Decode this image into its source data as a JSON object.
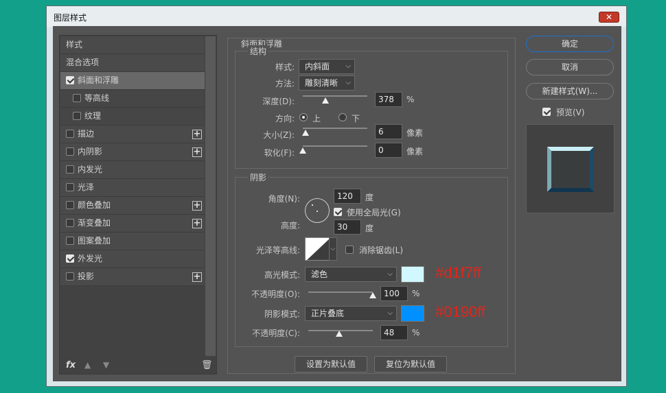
{
  "window": {
    "title": "图层样式",
    "close_label": "✕"
  },
  "sidebar": {
    "items": [
      {
        "label": "样式"
      },
      {
        "label": "混合选项"
      },
      {
        "label": "斜面和浮雕",
        "checked": true
      },
      {
        "label": "等高线",
        "checked": false
      },
      {
        "label": "纹理",
        "checked": false
      },
      {
        "label": "描边",
        "checked": false,
        "plus": "+"
      },
      {
        "label": "内阴影",
        "checked": false,
        "plus": "+"
      },
      {
        "label": "内发光",
        "checked": false
      },
      {
        "label": "光泽",
        "checked": false
      },
      {
        "label": "颜色叠加",
        "checked": false,
        "plus": "+"
      },
      {
        "label": "渐变叠加",
        "checked": false,
        "plus": "+"
      },
      {
        "label": "图案叠加",
        "checked": false
      },
      {
        "label": "外发光",
        "checked": true
      },
      {
        "label": "投影",
        "checked": false,
        "plus": "+"
      }
    ],
    "fx_label": "fx",
    "up_icon": "▲",
    "down_icon": "▼",
    "trash_icon": "🗑"
  },
  "main": {
    "title": "斜面和浮雕",
    "structure": {
      "label": "结构",
      "style_label": "样式:",
      "style_value": "内斜面",
      "method_label": "方法:",
      "method_value": "雕刻清晰",
      "depth_label": "深度(D):",
      "depth_value": "378",
      "depth_unit": "%",
      "depth_fraction": 0.35,
      "direction_label": "方向:",
      "direction_up": "上",
      "direction_down": "下",
      "size_label": "大小(Z):",
      "size_value": "6",
      "size_unit": "像素",
      "size_fraction": 0.04,
      "soften_label": "软化(F):",
      "soften_value": "0",
      "soften_unit": "像素",
      "soften_fraction": 0.0
    },
    "shading": {
      "label": "阴影",
      "angle_label": "角度(N):",
      "angle_value": "120",
      "angle_unit": "度",
      "global_light_label": "使用全局光(G)",
      "global_light_checked": true,
      "altitude_label": "高度:",
      "altitude_value": "30",
      "altitude_unit": "度",
      "gloss_contour_label": "光泽等高线:",
      "anti_alias_label": "消除锯齿(L)",
      "anti_alias_checked": false,
      "highlight_mode_label": "高光模式:",
      "highlight_mode_value": "滤色",
      "highlight_color": "#d1f7ff",
      "highlight_annotation": "#d1f7ff",
      "highlight_opacity_label": "不透明度(O):",
      "highlight_opacity_value": "100",
      "highlight_opacity_unit": "%",
      "highlight_opacity_fraction": 1.0,
      "shadow_mode_label": "阴影模式:",
      "shadow_mode_value": "正片叠底",
      "shadow_color": "#0190ff",
      "shadow_annotation": "#0190ff",
      "shadow_opacity_label": "不透明度(C):",
      "shadow_opacity_value": "48",
      "shadow_opacity_unit": "%",
      "shadow_opacity_fraction": 0.48
    },
    "make_default_label": "设置为默认值",
    "reset_default_label": "复位为默认值"
  },
  "actions": {
    "ok_label": "确定",
    "cancel_label": "取消",
    "new_style_label": "新建样式(W)...",
    "preview_label": "预览(V)",
    "preview_checked": true
  },
  "colors": {
    "accent": "#1e6fd0",
    "annotation": "#e0261c"
  }
}
